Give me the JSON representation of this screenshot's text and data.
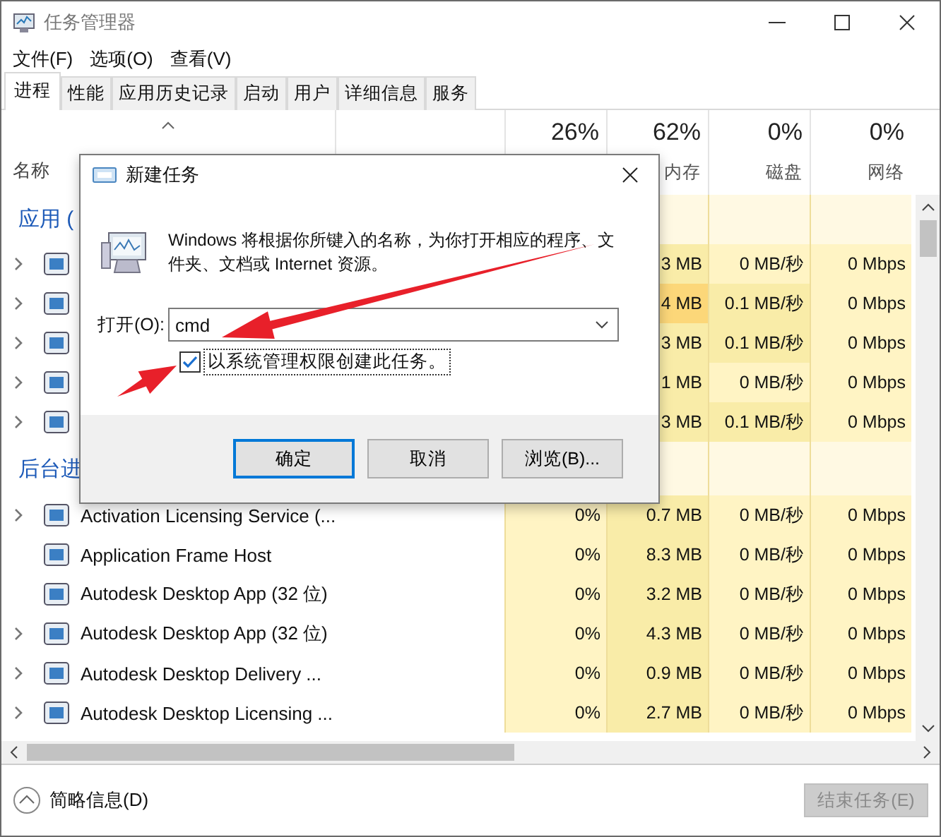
{
  "window": {
    "title": "任务管理器"
  },
  "menu": [
    "文件(F)",
    "选项(O)",
    "查看(V)"
  ],
  "tabs": [
    {
      "label": "进程",
      "selected": true
    },
    {
      "label": "性能",
      "selected": false
    },
    {
      "label": "应用历史记录",
      "selected": false
    },
    {
      "label": "启动",
      "selected": false
    },
    {
      "label": "用户",
      "selected": false
    },
    {
      "label": "详细信息",
      "selected": false
    },
    {
      "label": "服务",
      "selected": false
    }
  ],
  "table": {
    "name_column": "名称",
    "columns": [
      {
        "percent": "26%"
      },
      {
        "percent": "62%",
        "label": "内存"
      },
      {
        "percent": "0%",
        "label": "磁盘"
      },
      {
        "percent": "0%",
        "label": "网络"
      }
    ],
    "groups": [
      {
        "title": "应用 (",
        "rows": [
          {
            "expandable": true,
            "cells": [
              {},
              {
                "text": "3 MB",
                "color": "#f9eca8"
              },
              {
                "text": "0 MB/秒",
                "color": "#fff4c4"
              },
              {
                "text": "0 Mbps",
                "color": "#fff4c4"
              }
            ]
          },
          {
            "expandable": true,
            "cells": [
              {},
              {
                "text": "4 MB",
                "color": "#fcd779"
              },
              {
                "text": "0.1 MB/秒",
                "color": "#f9eca8"
              },
              {
                "text": "0 Mbps",
                "color": "#fff4c4"
              }
            ]
          },
          {
            "expandable": true,
            "cells": [
              {},
              {
                "text": "3 MB",
                "color": "#f9eca8"
              },
              {
                "text": "0.1 MB/秒",
                "color": "#f9eca8"
              },
              {
                "text": "0 Mbps",
                "color": "#fff4c4"
              }
            ]
          },
          {
            "expandable": true,
            "cells": [
              {},
              {
                "text": "1 MB",
                "color": "#f9eca8"
              },
              {
                "text": "0 MB/秒",
                "color": "#fff4c4"
              },
              {
                "text": "0 Mbps",
                "color": "#fff4c4"
              }
            ]
          },
          {
            "expandable": true,
            "cells": [
              {},
              {
                "text": "3 MB",
                "color": "#f9eca8"
              },
              {
                "text": "0.1 MB/秒",
                "color": "#f9eca8"
              },
              {
                "text": "0 Mbps",
                "color": "#fff4c4"
              }
            ]
          }
        ]
      },
      {
        "title": "后台进",
        "rows": [
          {
            "name": "Activation Licensing Service (...",
            "expandable": true,
            "cells": [
              {
                "text": "0%",
                "color": "#fff4c4"
              },
              {
                "text": "0.7 MB",
                "color": "#f9eca8"
              },
              {
                "text": "0 MB/秒",
                "color": "#fff4c4"
              },
              {
                "text": "0 Mbps",
                "color": "#fff4c4"
              }
            ]
          },
          {
            "name": "Application Frame Host",
            "expandable": false,
            "cells": [
              {
                "text": "0%",
                "color": "#fff4c4"
              },
              {
                "text": "8.3 MB",
                "color": "#f9eca8"
              },
              {
                "text": "0 MB/秒",
                "color": "#fff4c4"
              },
              {
                "text": "0 Mbps",
                "color": "#fff4c4"
              }
            ]
          },
          {
            "name": "Autodesk Desktop App (32 位)",
            "expandable": false,
            "cells": [
              {
                "text": "0%",
                "color": "#fff4c4"
              },
              {
                "text": "3.2 MB",
                "color": "#f9eca8"
              },
              {
                "text": "0 MB/秒",
                "color": "#fff4c4"
              },
              {
                "text": "0 Mbps",
                "color": "#fff4c4"
              }
            ]
          },
          {
            "name": "Autodesk Desktop App (32 位)",
            "expandable": true,
            "cells": [
              {
                "text": "0%",
                "color": "#fff4c4"
              },
              {
                "text": "4.3 MB",
                "color": "#f9eca8"
              },
              {
                "text": "0 MB/秒",
                "color": "#fff4c4"
              },
              {
                "text": "0 Mbps",
                "color": "#fff4c4"
              }
            ]
          },
          {
            "name": "Autodesk Desktop Delivery ...",
            "expandable": true,
            "cells": [
              {
                "text": "0%",
                "color": "#fff4c4"
              },
              {
                "text": "0.9 MB",
                "color": "#f9eca8"
              },
              {
                "text": "0 MB/秒",
                "color": "#fff4c4"
              },
              {
                "text": "0 Mbps",
                "color": "#fff4c4"
              }
            ]
          },
          {
            "name": "Autodesk Desktop Licensing ...",
            "expandable": true,
            "cells": [
              {
                "text": "0%",
                "color": "#fff4c4"
              },
              {
                "text": "2.7 MB",
                "color": "#f9eca8"
              },
              {
                "text": "0 MB/秒",
                "color": "#fff4c4"
              },
              {
                "text": "0 Mbps",
                "color": "#fff4c4"
              }
            ]
          }
        ]
      }
    ]
  },
  "footer": {
    "details_link": "简略信息(D)",
    "end_task_button": {
      "label": "结束任务(E)",
      "disabled": true
    }
  },
  "dialog": {
    "title": "新建任务",
    "message": "Windows 将根据你所键入的名称，为你打开相应的程序、文件夹、文档或 Internet 资源。",
    "open_label": "打开(O):",
    "open_value": "cmd",
    "admin_checkbox": {
      "label": "以系统管理权限创建此任务。",
      "checked": true
    },
    "buttons": [
      {
        "label": "确定",
        "default": true
      },
      {
        "label": "取消",
        "default": false
      },
      {
        "label": "浏览(B)...",
        "default": false
      }
    ]
  }
}
